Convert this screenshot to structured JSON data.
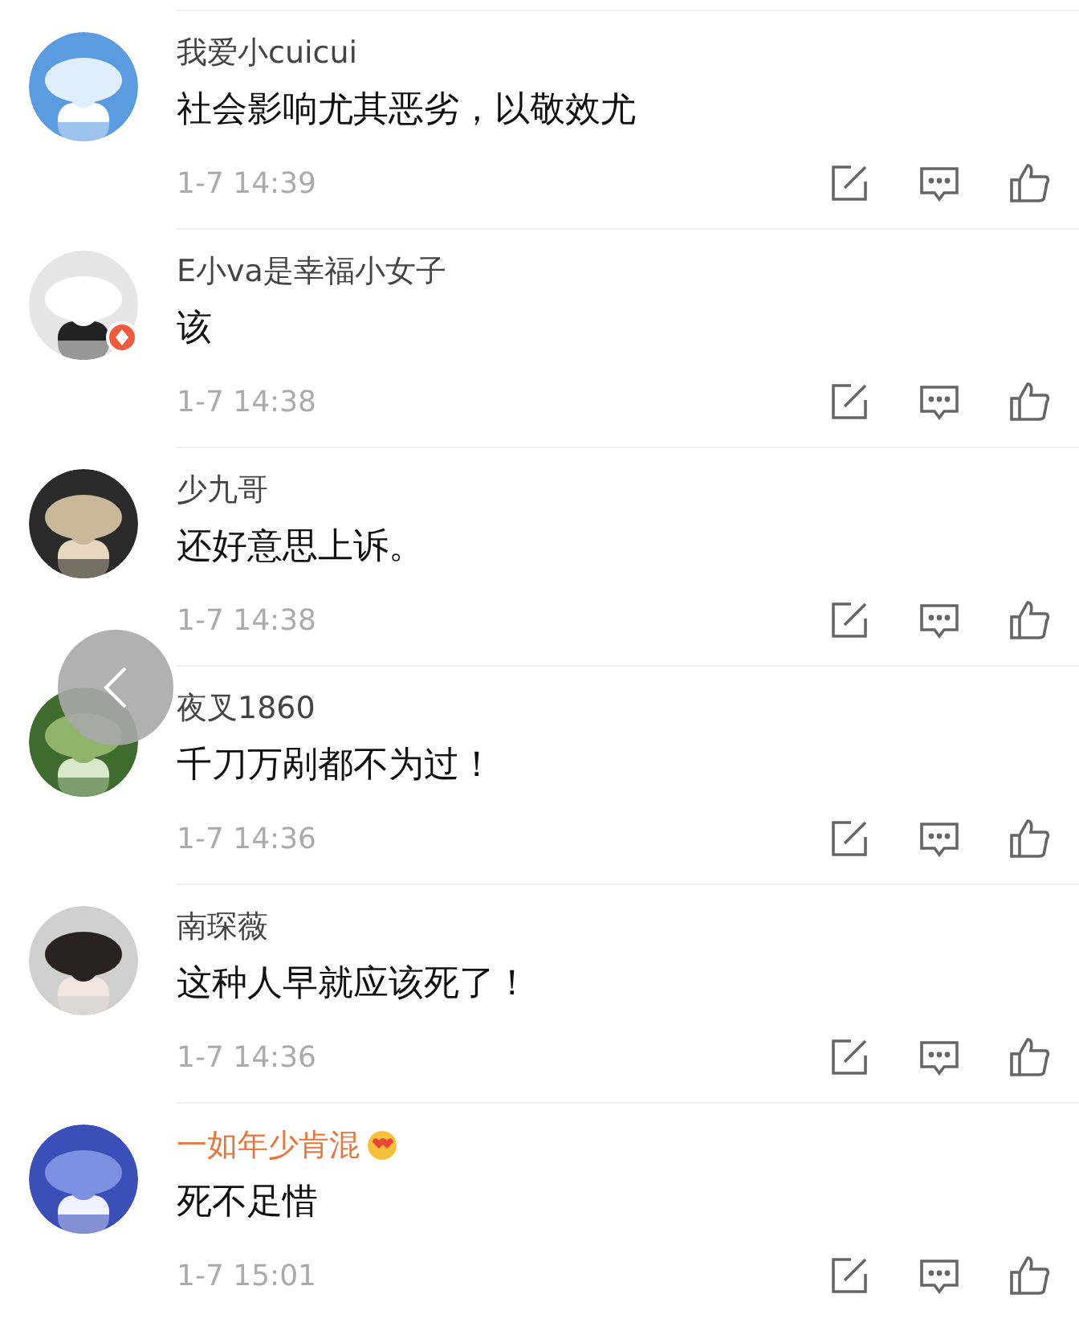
{
  "comments": [
    {
      "name": "我爱小cuicui",
      "vip": false,
      "verified": false,
      "text": "社会影响尤其恶劣，以敬效尤",
      "time": "1-7 14:39"
    },
    {
      "name": "E小va是幸福小女子",
      "vip": false,
      "verified": true,
      "text": "该",
      "time": "1-7 14:38"
    },
    {
      "name": "少九哥",
      "vip": false,
      "verified": false,
      "text": "还好意思上诉。",
      "time": "1-7 14:38"
    },
    {
      "name": "夜叉1860",
      "vip": false,
      "verified": false,
      "text": "千刀万剐都不为过！",
      "time": "1-7 14:36"
    },
    {
      "name": "南琛薇",
      "vip": false,
      "verified": false,
      "text": "这种人早就应该死了！",
      "time": "1-7 14:36"
    },
    {
      "name": "一如年少肯混",
      "vip": true,
      "verified": false,
      "text": "死不足惜",
      "time": "1-7 15:01"
    }
  ]
}
